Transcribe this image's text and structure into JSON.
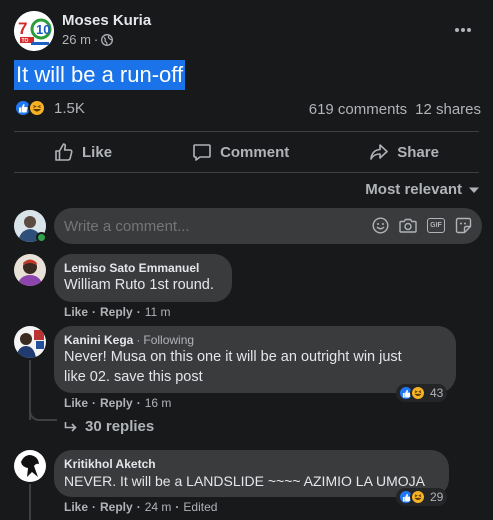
{
  "post": {
    "author": "Moses Kuria",
    "time": "26 m",
    "dot": "·",
    "text": "It will be a run-off",
    "reaction_count": "1.5K",
    "comments": "619 comments",
    "shares": "12 shares",
    "page_logo_text": "7TO10"
  },
  "actions": {
    "like": "Like",
    "comment": "Comment",
    "share": "Share"
  },
  "sort": {
    "label": "Most relevant"
  },
  "composer": {
    "placeholder": "Write a comment...",
    "gif": "GIF"
  },
  "comments": [
    {
      "name": "Lemiso Sato Emmanuel",
      "text": "William Ruto 1st round.",
      "like": "Like",
      "reply": "Reply",
      "time": "11 m"
    },
    {
      "name": "Kanini Kega",
      "following": "Following",
      "text_line1": "Never! Musa on this one it will be an outright win just",
      "text_line2": "like 02. save this post",
      "like": "Like",
      "reply": "Reply",
      "time": "16 m",
      "reactions": "43",
      "replies": "30 replies"
    },
    {
      "name": "Kritikhol Aketch",
      "text": "NEVER. It will be a LANDSLIDE ~~~~ AZIMIO LA UMOJA",
      "like": "Like",
      "reply": "Reply",
      "time": "24 m",
      "edited": "Edited",
      "reactions": "29"
    }
  ],
  "colors": {
    "background": "#18191a",
    "bubble": "#3a3b3c",
    "highlight": "#1a73e8",
    "like_blue": "#2078f4",
    "haha_yellow": "#f7b125",
    "online_green": "#31a24c"
  }
}
